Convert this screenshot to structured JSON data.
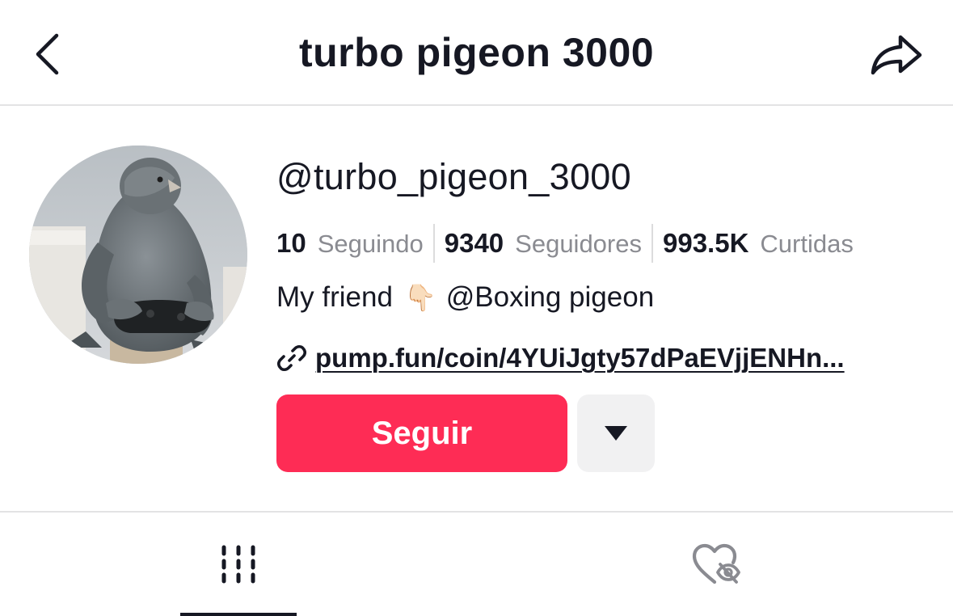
{
  "header": {
    "title": "turbo pigeon 3000",
    "back_icon": "chevron-left-icon",
    "share_icon": "share-arrow-icon"
  },
  "profile": {
    "username": "@turbo_pigeon_3000",
    "avatar": "pigeon-holding-game-controller",
    "stats": [
      {
        "value": "10",
        "label": "Seguindo"
      },
      {
        "value": "9340",
        "label": "Seguidores"
      },
      {
        "value": "993.5K",
        "label": "Curtidas"
      }
    ],
    "bio": {
      "text": "My friend",
      "emoji": "👇🏻",
      "mention": "@Boxing pigeon"
    },
    "link": {
      "icon": "link-icon",
      "text": "pump.fun/coin/4YUiJgty57dPaEVjjENHn..."
    },
    "follow_label": "Seguir",
    "more_icon": "caret-down-icon"
  },
  "tabs": [
    {
      "name": "videos",
      "icon": "grid-lines-icon",
      "active": true
    },
    {
      "name": "liked",
      "icon": "heart-hidden-icon",
      "active": false
    }
  ],
  "colors": {
    "primary_text": "#161823",
    "secondary_text": "#8a8b91",
    "follow_button": "#fe2c55",
    "secondary_button": "#f1f1f2",
    "divider": "#e3e3e4"
  }
}
